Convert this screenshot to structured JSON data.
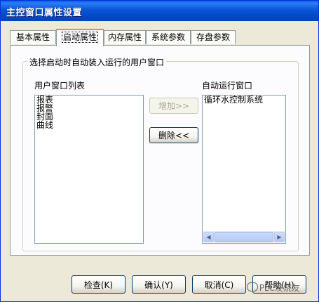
{
  "window": {
    "title": "主控窗口属性设置"
  },
  "tabs": [
    {
      "label": "基本属性"
    },
    {
      "label": "启动属性",
      "active": true
    },
    {
      "label": "内存属性"
    },
    {
      "label": "系统参数"
    },
    {
      "label": "存盘参数"
    }
  ],
  "group": {
    "legend": "选择启动时自动装入运行的用户窗口"
  },
  "user_windows": {
    "label": "用户窗口列表",
    "items": [
      "报表",
      "报警",
      "封面",
      "曲线"
    ]
  },
  "auto_windows": {
    "label": "自动运行窗口",
    "items": [
      "循环水控制系统"
    ]
  },
  "buttons": {
    "add": "增加>>",
    "delete": "删除<<",
    "check": "检查(K)",
    "ok": "确认(Y)",
    "cancel": "取消(C)",
    "help": "帮助(H)"
  },
  "watermark": {
    "text": "PLC发烧友"
  }
}
